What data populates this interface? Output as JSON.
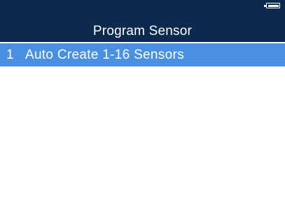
{
  "status_bar": {
    "battery_icon": "battery-full-icon"
  },
  "header": {
    "title": "Program Sensor",
    "background_color": "#0c2a4f"
  },
  "menu": {
    "selected_color": "#4a90e2",
    "items": [
      {
        "index": "1",
        "label": "Auto Create 1-16 Sensors",
        "selected": true
      }
    ]
  }
}
